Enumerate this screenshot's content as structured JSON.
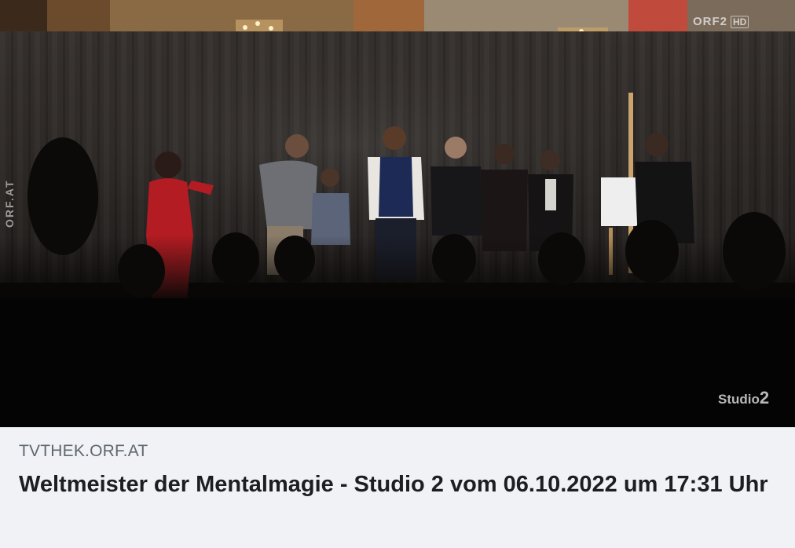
{
  "link_preview": {
    "domain": "TVTHEK.ORF.AT",
    "title": "Weltmeister der Mentalmagie - Studio 2 vom 06.10.2022 um 17:31 Uhr"
  },
  "video_frame": {
    "channel_logo": "ORF2",
    "hd_badge": "HD",
    "side_watermark": "ORF.AT",
    "show_logo": "Studio",
    "show_logo_number": "2"
  },
  "colors": {
    "card_background": "#f0f2f5",
    "domain_text": "#606770",
    "title_text": "#1c1e21",
    "stage_curtain": "#2a2624"
  }
}
